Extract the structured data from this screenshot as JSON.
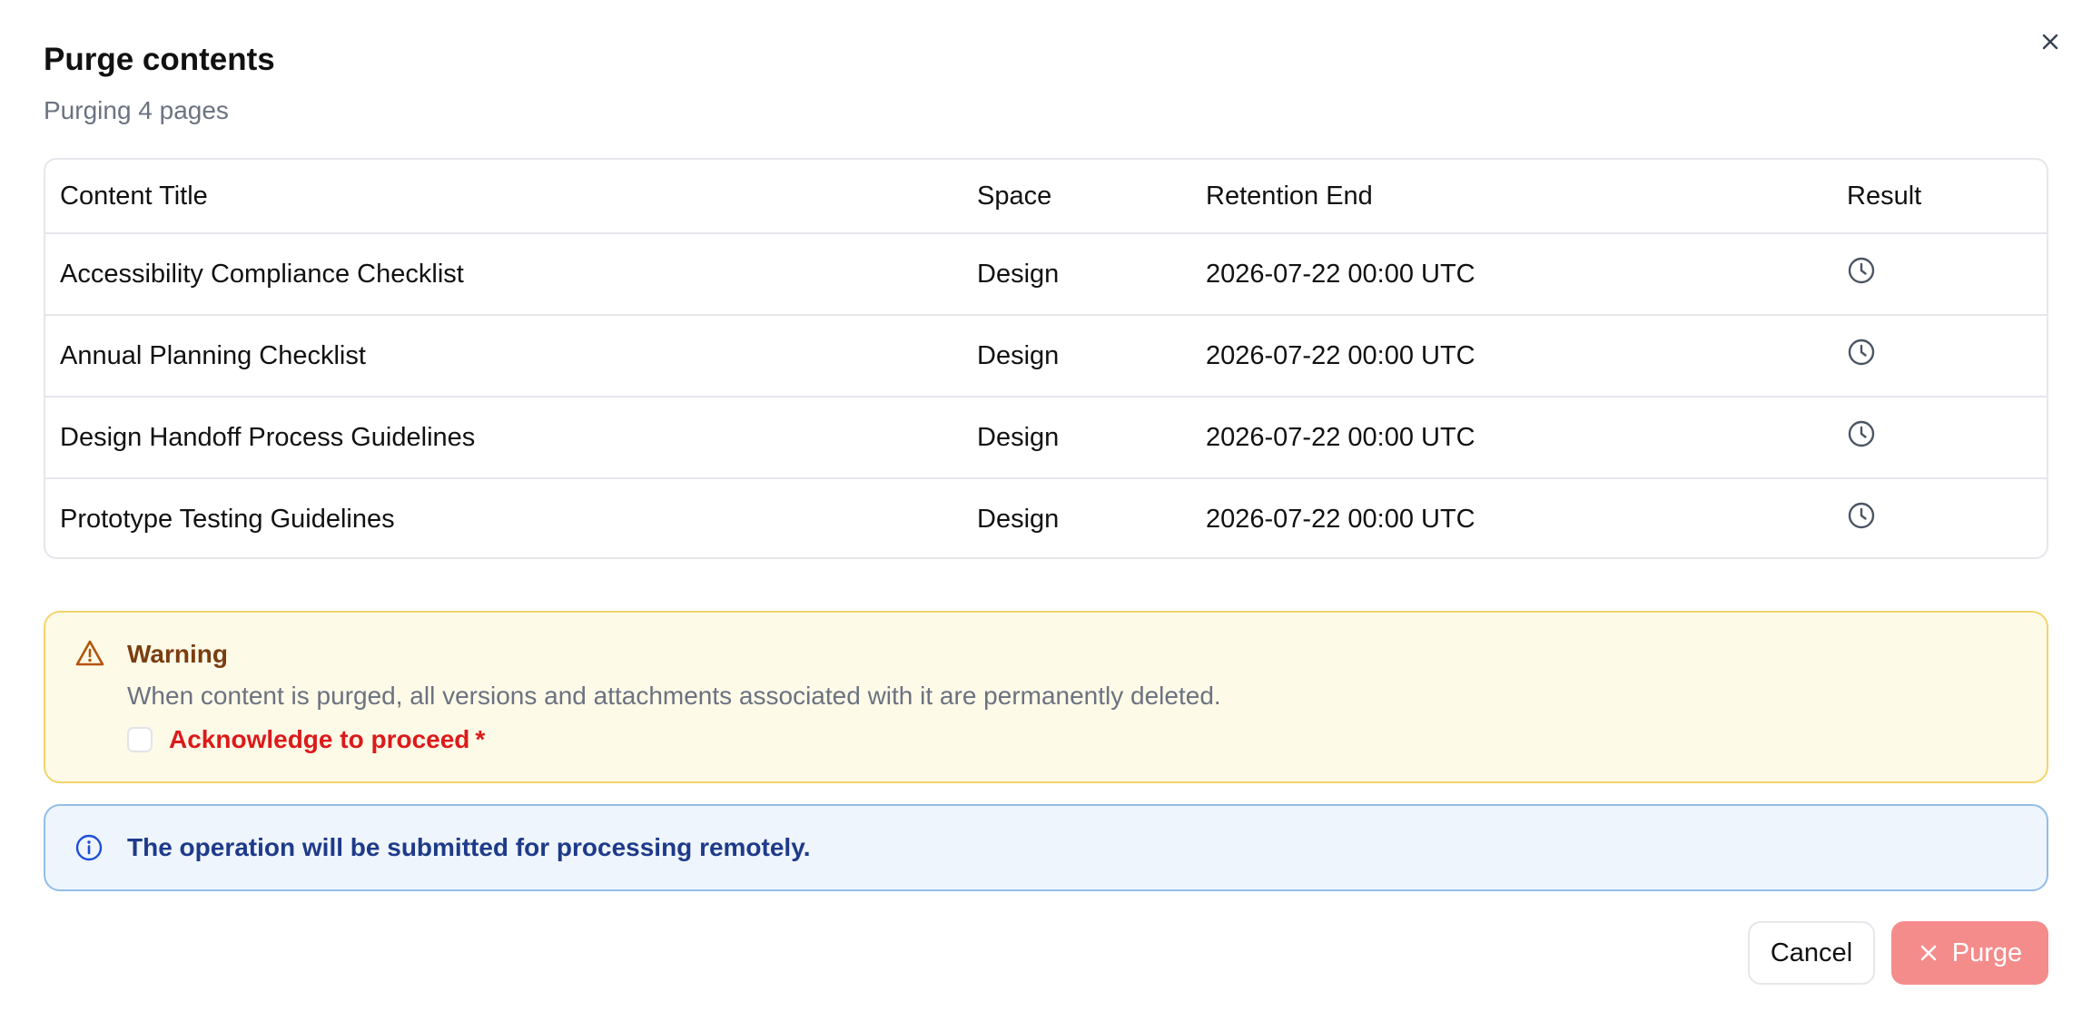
{
  "dialog": {
    "title": "Purge contents",
    "subtitle": "Purging 4 pages",
    "close_icon": "close-icon"
  },
  "table": {
    "columns": [
      "Content Title",
      "Space",
      "Retention End",
      "Result"
    ],
    "rows": [
      {
        "title": "Accessibility Compliance Checklist",
        "space": "Design",
        "retention_end": "2026-07-22 00:00 UTC",
        "result_icon": "clock-icon"
      },
      {
        "title": "Annual Planning Checklist",
        "space": "Design",
        "retention_end": "2026-07-22 00:00 UTC",
        "result_icon": "clock-icon"
      },
      {
        "title": "Design Handoff Process Guidelines",
        "space": "Design",
        "retention_end": "2026-07-22 00:00 UTC",
        "result_icon": "clock-icon"
      },
      {
        "title": "Prototype Testing Guidelines",
        "space": "Design",
        "retention_end": "2026-07-22 00:00 UTC",
        "result_icon": "clock-icon"
      }
    ]
  },
  "warning": {
    "icon": "warning-triangle-icon",
    "title": "Warning",
    "text": "When content is purged, all versions and attachments associated with it are permanently deleted.",
    "acknowledge_label": "Acknowledge to proceed",
    "required_marker": "*",
    "acknowledged": false
  },
  "info": {
    "icon": "info-icon",
    "text": "The operation will be submitted for processing remotely."
  },
  "actions": {
    "cancel_label": "Cancel",
    "purge_label": "Purge",
    "purge_icon": "close-icon"
  },
  "colors": {
    "warning_bg": "#fefae8",
    "warning_border": "#f3d36b",
    "info_bg": "#eef5fd",
    "info_border": "#93bde8",
    "danger": "#dc1a1a",
    "purge_disabled": "#f58c8c"
  }
}
